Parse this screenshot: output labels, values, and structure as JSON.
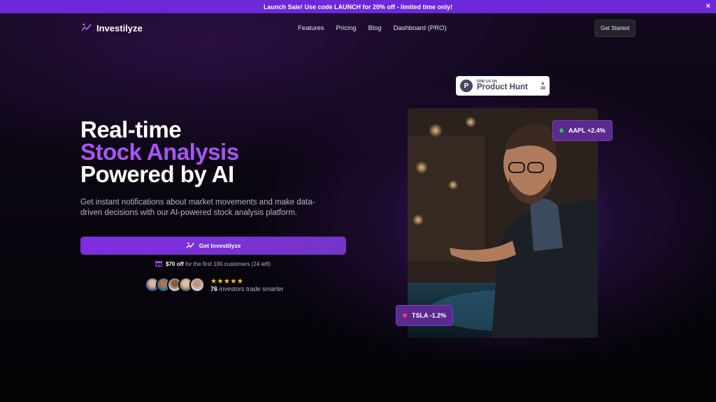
{
  "banner": {
    "text": "Launch Sale! Use code LAUNCH for 20% off - limited time only!",
    "close": "×"
  },
  "nav": {
    "brand": "Investilyze",
    "links": [
      "Features",
      "Pricing",
      "Blog",
      "Dashboard (PRO)"
    ],
    "cta": "Get Started"
  },
  "hero": {
    "title_line1": "Real-time",
    "title_line2": "Stock Analysis",
    "title_line3": "Powered by AI",
    "subtitle": "Get instant notifications about market movements and make data-driven decisions with our AI-powered stock analysis platform.",
    "cta": "Get Investilyze",
    "offer_amount": "$70 off",
    "offer_rest": "for the first 100 customers (24 left)",
    "stars": "★★★★★",
    "investors_count": "76",
    "investors_text": "investors trade smarter"
  },
  "product_hunt": {
    "small": "FIND US ON",
    "big": "Product Hunt",
    "votes": "38",
    "arrow": "▲",
    "logo": "P"
  },
  "tickers": [
    {
      "label": "AAPL +2.4%",
      "dot": "#22c55e"
    },
    {
      "label": "TSLA -1.2%",
      "dot": "#f43f5e"
    }
  ],
  "colors": {
    "accent": "#a855f7",
    "banner": "#6d28d9",
    "cta": "#7e2ee0"
  }
}
